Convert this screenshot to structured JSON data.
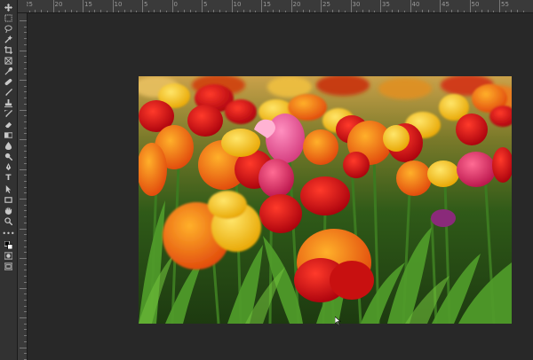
{
  "app": {
    "name": "Image editor"
  },
  "toolbar": {
    "tools": [
      {
        "name": "move-tool",
        "icon": "move-icon"
      },
      {
        "name": "marquee-tool",
        "icon": "marquee-icon"
      },
      {
        "name": "lasso-tool",
        "icon": "lasso-icon"
      },
      {
        "name": "quick-selection-tool",
        "icon": "wand-icon"
      },
      {
        "name": "crop-tool",
        "icon": "crop-icon"
      },
      {
        "name": "frame-tool",
        "icon": "frame-icon"
      },
      {
        "name": "eyedropper-tool",
        "icon": "eyedropper-icon"
      },
      {
        "name": "healing-brush-tool",
        "icon": "bandage-icon"
      },
      {
        "name": "brush-tool",
        "icon": "brush-icon"
      },
      {
        "name": "clone-stamp-tool",
        "icon": "stamp-icon"
      },
      {
        "name": "history-brush-tool",
        "icon": "history-brush-icon"
      },
      {
        "name": "eraser-tool",
        "icon": "eraser-icon"
      },
      {
        "name": "gradient-tool",
        "icon": "gradient-icon"
      },
      {
        "name": "blur-tool",
        "icon": "droplet-icon"
      },
      {
        "name": "dodge-tool",
        "icon": "dodge-icon"
      },
      {
        "name": "pen-tool",
        "icon": "pen-icon"
      },
      {
        "name": "type-tool",
        "icon": "type-icon",
        "glyph": "T"
      },
      {
        "name": "path-selection-tool",
        "icon": "arrow-icon"
      },
      {
        "name": "rectangle-tool",
        "icon": "rectangle-icon"
      },
      {
        "name": "hand-tool",
        "icon": "hand-icon"
      },
      {
        "name": "zoom-tool",
        "icon": "zoom-icon"
      },
      {
        "name": "more-tools",
        "icon": "ellipsis-icon",
        "glyph": "•••"
      },
      {
        "name": "color-swatches",
        "icon": "swatches-icon"
      },
      {
        "name": "quick-mask",
        "icon": "quick-mask-icon"
      },
      {
        "name": "screen-mode",
        "icon": "screen-mode-icon"
      }
    ]
  },
  "ruler": {
    "ticks": [
      "25",
      "20",
      "15",
      "10",
      "5",
      "0",
      "5",
      "10",
      "15",
      "20",
      "25",
      "30",
      "35",
      "40",
      "45",
      "50",
      "55"
    ]
  },
  "document": {
    "image": "tulip-field-photo"
  },
  "colors": {
    "panel": "#323232",
    "ruler": "#3a3a3a",
    "pasteboard": "#282828"
  }
}
